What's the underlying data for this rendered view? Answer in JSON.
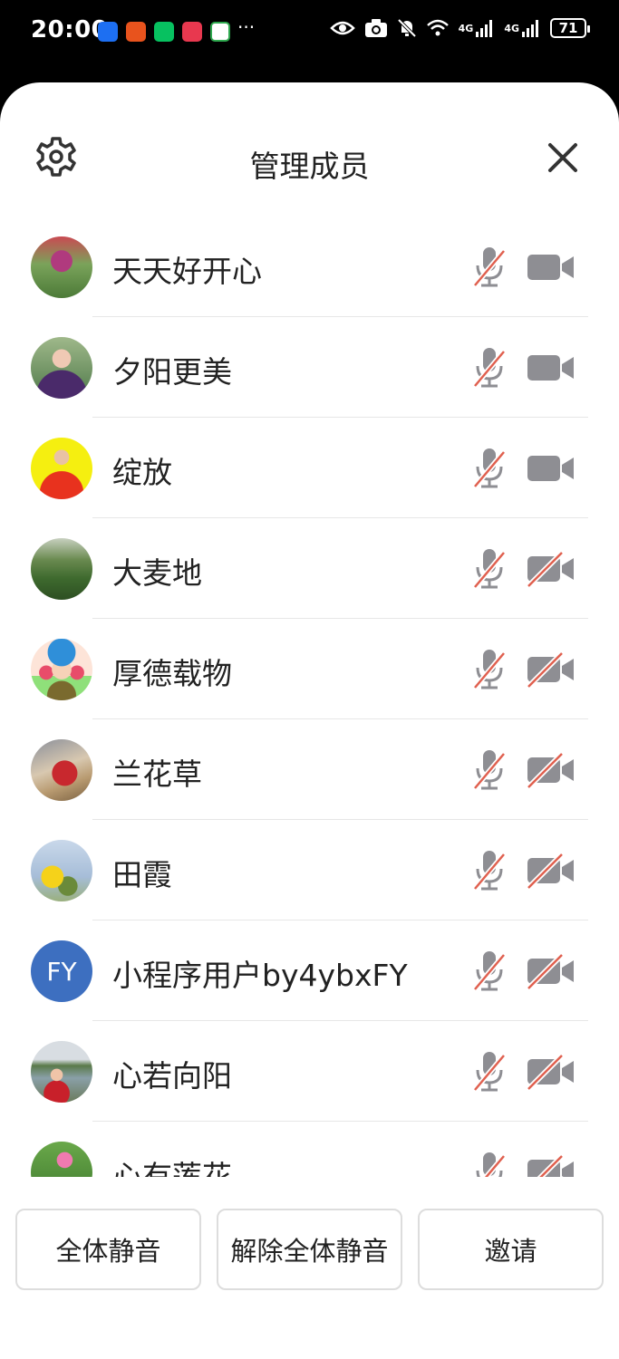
{
  "status_bar": {
    "time": "20:00",
    "more": "···",
    "network_1": "4G",
    "network_2": "4G",
    "battery": "71"
  },
  "header": {
    "title": "管理成员"
  },
  "members": [
    {
      "name": "天天好开心",
      "mic": "muted",
      "camera": "on"
    },
    {
      "name": "夕阳更美",
      "mic": "muted",
      "camera": "on"
    },
    {
      "name": "绽放",
      "mic": "muted",
      "camera": "on"
    },
    {
      "name": "大麦地",
      "mic": "muted",
      "camera": "off"
    },
    {
      "name": "厚德载物",
      "mic": "muted",
      "camera": "off"
    },
    {
      "name": "兰花草",
      "mic": "muted",
      "camera": "off"
    },
    {
      "name": "田霞",
      "mic": "muted",
      "camera": "off"
    },
    {
      "name": "小程序用户by4ybxFY",
      "mic": "muted",
      "camera": "off",
      "avatar_text": "FY"
    },
    {
      "name": "心若向阳",
      "mic": "muted",
      "camera": "off"
    },
    {
      "name": "心有莲花",
      "mic": "muted",
      "camera": "off"
    }
  ],
  "footer": {
    "mute_all": "全体静音",
    "unmute_all": "解除全体静音",
    "invite": "邀请"
  },
  "colors": {
    "icon_gray": "#8e8e93",
    "muted_slash": "#e0604f",
    "fy_avatar": "#3d6fc0"
  }
}
